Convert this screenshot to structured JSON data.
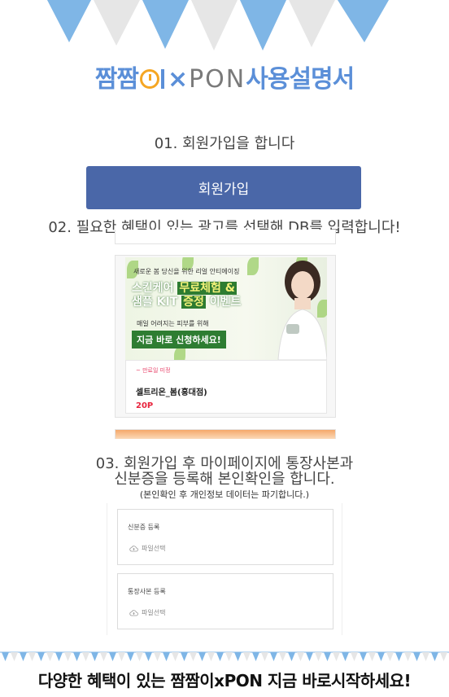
{
  "colors": {
    "brand_blue": "#5b8fd8",
    "join_button": "#4a67a8",
    "bunting_blue": "#7fb6e6",
    "bunting_grey": "#e6e6e6",
    "points_red": "#e8253e",
    "ad_green": "#2e7d32"
  },
  "logo": {
    "part1": "짬짬",
    "part2": "I",
    "x": "×",
    "pon": "PON",
    "title": "사용설명서"
  },
  "steps": {
    "step1": "01. 회원가입을 합니다",
    "join_button_label": "회원가입",
    "step2": "02. 필요한 혜택이 있는 광고를 선택해 DB를 입력합니다!",
    "step3_line1": "03. 회원가입 후 마이페이지에 통장사본과",
    "step3_line2": "신분증을 등록해 본인확인을 합니다.",
    "step3_note": "(본인확인 후 개인정보 데이터는 파기합니다.)"
  },
  "ad": {
    "subtitle": "새로운 봄 당신을 위한 리얼 안티에이징",
    "headline_1a": "스킨케어 ",
    "headline_1b": "무료체험 &",
    "headline_2a": "샘플 KIT ",
    "headline_2b": "증정",
    "headline_2c": " 이벤트",
    "small_text": "매일 어려지는 피부를 위해",
    "cta": "지금 바로 신청하세요!",
    "deadline": "~ 만료일 미정",
    "name": "셀트리온_봄(홍대점)",
    "points": "20P"
  },
  "uploads": [
    {
      "label": "신분증 등록",
      "file_label": "파일선택",
      "icon": "cloud-upload-icon"
    },
    {
      "label": "통장사본 등록",
      "file_label": "파일선택",
      "icon": "cloud-upload-icon"
    }
  ],
  "footer": {
    "text": "다양한 혜택이 있는 짬짬이xPON 지금 바로시작하세요!"
  }
}
